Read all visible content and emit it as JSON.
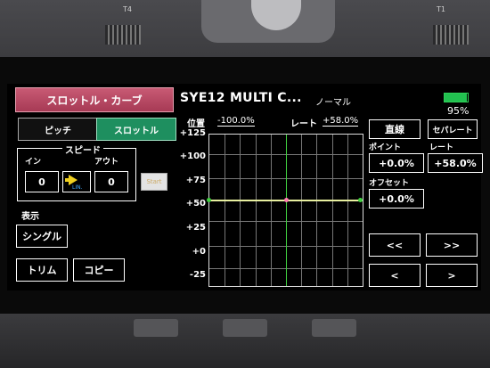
{
  "hardware": {
    "left_label": "T4",
    "right_label": "T1"
  },
  "header": {
    "screen_title": "スロットル・カーブ",
    "model_name": "SYE12 MULTI C...",
    "condition": "ノーマル",
    "battery_percent": "95%",
    "battery_level": 0.95
  },
  "tabs": {
    "pitch": "ピッチ",
    "throttle": "スロットル"
  },
  "speed": {
    "title": "スピード",
    "in_label": "イン",
    "out_label": "アウト",
    "in_value": "0",
    "out_value": "0",
    "link_label": "LIN."
  },
  "start_label": "Start",
  "display": {
    "label": "表示",
    "single_button": "シングル",
    "trim_button": "トリム",
    "copy_button": "コピー"
  },
  "graph": {
    "pos_label": "位置",
    "pos_value": "-100.0%",
    "rate_label": "レート",
    "rate_value": "+58.0%",
    "y_ticks": [
      "+125",
      "+100",
      "+75",
      "+50",
      "+25",
      "+0",
      "-25"
    ]
  },
  "right_panel": {
    "straight_button": "直線",
    "separate_button": "セパレート",
    "point_label": "ポイント",
    "point_rate_label": "レート",
    "point_value": "+0.0%",
    "rate_value": "+58.0%",
    "offset_label": "オフセット",
    "offset_value": "+0.0%",
    "nav_first": "<<",
    "nav_last": ">>",
    "nav_prev": "<",
    "nav_next": ">"
  },
  "colors": {
    "title_bar": "#b44862",
    "tab_active": "#1e8f5f",
    "curve": "#e8f0a0",
    "center_line": "#40d040",
    "battery": "#22c050"
  }
}
